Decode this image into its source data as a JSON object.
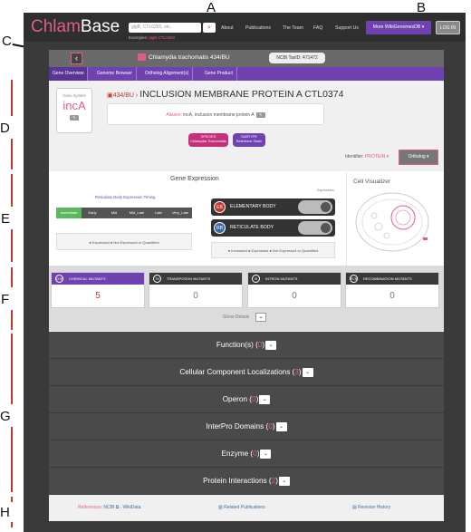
{
  "annotations": {
    "a": "A",
    "b": "B",
    "c": "C",
    "d": "D",
    "e": "E",
    "f": "F",
    "g": "G",
    "h": "H"
  },
  "navbar": {
    "logo_part1": "Chlam",
    "logo_part2": "Base",
    "search_placeholder": "glgB, CTL0260, etc.",
    "examples_label": "Examples:",
    "example1": "glgB",
    "example2": "CTL0260",
    "links": [
      "About",
      "Publications",
      "The Team",
      "FAQ",
      "Support Us"
    ],
    "more_label": "More WikiGenomesDB ▾",
    "login_label": "LOG IN"
  },
  "organism": {
    "back_label": "‹",
    "name": "Chlamydia trachomatis 434/BU",
    "taxid_label": "NCBI TaxID: 471472"
  },
  "tabs": [
    "Gene Overview",
    "Genome Browser",
    "Ortholog Alignment(s)",
    "Gene Product"
  ],
  "gene": {
    "symbol_label": "Gene Symbol",
    "symbol": "incA",
    "strain_tag": "434/BU",
    "title": "INCLUSION MEMBRANE PROTEIN A CTL0374",
    "aliases_label": "Aliases:",
    "aliases": "incA, inclusion membrane protein A",
    "species_pill_1": "SPECIES",
    "species_pill_2": "Chlamydia Trachomatis",
    "subtype_pill_1": "SUBTYPE",
    "subtype_pill_2": "Reference Strain",
    "identifier_label": "Identifier:",
    "identifier_value": "PROTEIN ▾",
    "ortholog_label": "Ortholog ▾"
  },
  "expression": {
    "title": "Gene Expression",
    "timing_title": "Reticulate Body Expression Timing",
    "stages": [
      "Immediate",
      "Early",
      "Mid",
      "Mid_Late",
      "Late",
      "Very_Late"
    ],
    "legend1": "● Expressed ● Not Expressed or Quantified",
    "expression_label": "Expression",
    "eb_badge": "EB",
    "eb_label": "ELEMENTARY BODY",
    "rb_badge": "RB",
    "rb_label": "RETICULATE BODY",
    "legend2": "● Increased ● Expressed ● Not Expressed or Quantified",
    "cell_vis_title": "Cell Visualizer"
  },
  "mutants": [
    {
      "abbr": "CHE",
      "label": "CHEMICAL MUTANTS",
      "count": "5"
    },
    {
      "abbr": "TN",
      "label": "TRANSPOSON MUTANTS",
      "count": "0"
    },
    {
      "abbr": "IN",
      "label": "INTRON MUTANTS",
      "count": "0"
    },
    {
      "abbr": "RCB",
      "label": "RECOMBINATION MUTANTS",
      "count": "0"
    }
  ],
  "show_details": "Show Details",
  "sections": [
    {
      "label": "Function(s)",
      "count": "0"
    },
    {
      "label": "Cellular Component Localizations",
      "count": "3"
    },
    {
      "label": "Operon",
      "count": "0"
    },
    {
      "label": "InterPro Domains",
      "count": "0"
    },
    {
      "label": "Enzyme",
      "count": "0"
    },
    {
      "label": "Protein Interactions",
      "count": "2"
    }
  ],
  "footer": {
    "references_label": "References:",
    "ncbi": "NCBI",
    "wikidata": "WikiData",
    "related_publications": "Related Publications",
    "revision_history": "Revision History"
  },
  "colors": {
    "brand_pink": "#e05d86",
    "brand_purple": "#6f42b1",
    "dark": "#3a3a3a"
  }
}
